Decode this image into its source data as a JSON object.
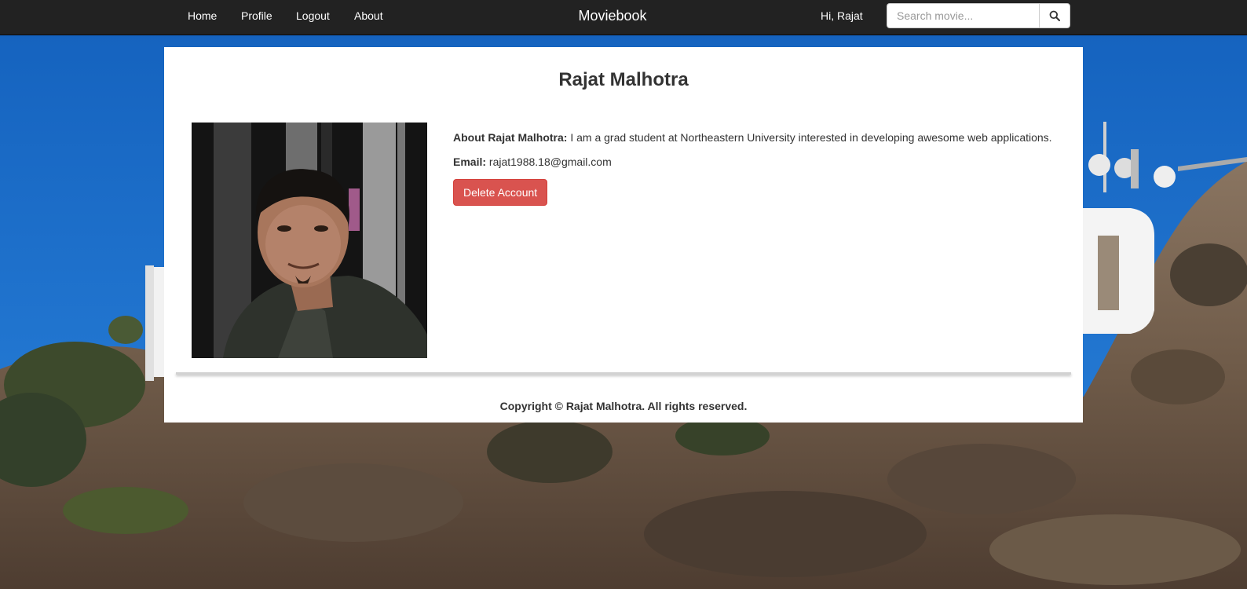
{
  "navbar": {
    "links": {
      "home": "Home",
      "profile": "Profile",
      "logout": "Logout",
      "about": "About"
    },
    "brand": "Moviebook",
    "greeting": "Hi, Rajat",
    "search": {
      "placeholder": "Search movie...",
      "value": ""
    },
    "search_icon": "search-icon",
    "background_color": "#222222"
  },
  "profile": {
    "name": "Rajat Malhotra",
    "about_label": "About Rajat Malhotra:",
    "about_text": "I am a grad student at Northeastern University interested in developing awesome web applications.",
    "email_label": "Email:",
    "email_value": "rajat1988.18@gmail.com",
    "delete_button": "Delete Account",
    "delete_button_color": "#d9534f"
  },
  "footer": {
    "copyright": "Copyright © Rajat Malhotra. All rights reserved."
  }
}
